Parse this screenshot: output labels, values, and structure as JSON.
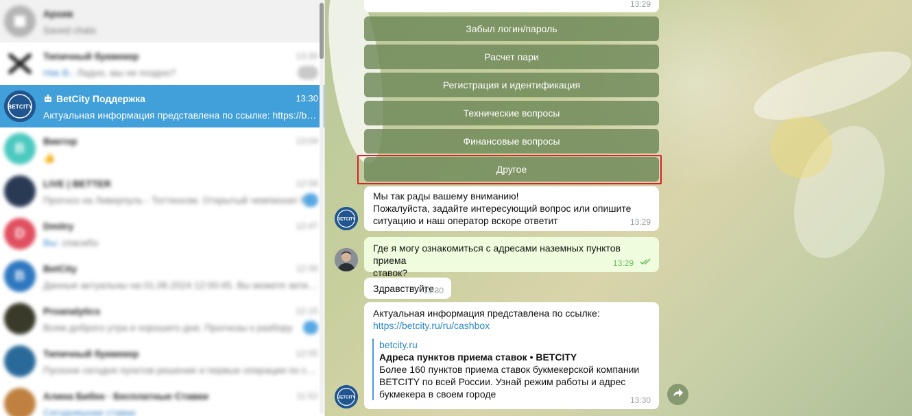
{
  "sidebar": {
    "chats": [
      {
        "title": "Архив",
        "preview": "Saved chats",
        "time": "",
        "avatar_color": "#b0b0b0",
        "blurred": true
      },
      {
        "title": "Типичный букмекер",
        "preview_highlight": "Ник В.:",
        "preview": "Ладно, мы не поздно?",
        "time": "13:30",
        "avatar_color": "#ffffff",
        "badge": "muted",
        "blurred": true
      },
      {
        "title": "BetCity Поддержка",
        "preview": "Актуальная информация представлена по ссылке: https://betcity.ru/ru/cashbox",
        "time": "13:30",
        "active": true,
        "blurred": false
      },
      {
        "title": "Виктор",
        "preview": "👍",
        "time": "13:04",
        "avatar_color": "#4cc9c0",
        "blurred": true
      },
      {
        "title": "LIVE | BETTER",
        "preview": "Прогноз на Ливерпуль - Тоттенхэм. Открытый чемпионат России",
        "time": "12:58",
        "avatar_color": "#2a3a55",
        "badge": "unread",
        "blurred": true
      },
      {
        "title": "Dmitry",
        "preview_highlight": "Вы:",
        "preview": "спасибо",
        "time": "12:47",
        "avatar_color": "#e04f5f",
        "blurred": true
      },
      {
        "title": "BetCity",
        "preview": "Данные актуальны на 01.06.2024 12:00:45. Вы можете активировать",
        "time": "12:30",
        "avatar_color": "#2e78c0",
        "blurred": true
      },
      {
        "title": "Proanalytics",
        "preview": "Всем доброго утра и хорошего дня. Прогнозы к разбору",
        "time": "12:15",
        "avatar_color": "#3a3a2a",
        "badge": "unread",
        "blurred": true
      },
      {
        "title": "Типичный букмекер",
        "preview": "Пусконе сегодня пунктов решение и первые операции по ставкам",
        "time": "12:05",
        "avatar_color": "#2a6a9a",
        "blurred": true
      },
      {
        "title": "Алина Бибек · Бесплатные Ставки",
        "preview": "Сегодняшние ставки",
        "time": "11:52",
        "avatar_color": "#c08040",
        "blurred": true
      }
    ],
    "active_chat": {
      "title": "BetCity Поддержка",
      "time": "13:30",
      "preview": "Актуальная информация представлена по ссылке: https://betcity.ru/ru/cashbox"
    }
  },
  "chat": {
    "top_time": "13:29",
    "keyboard": [
      "Забыл логин/пароль",
      "Расчет пари",
      "Регистрация и идентификация",
      "Технические вопросы",
      "Финансовые вопросы",
      "Другое"
    ],
    "bot_greeting": {
      "lines": [
        "Мы так рады вашему вниманию!",
        "Пожалуйста, задайте интересующий вопрос или опишите",
        "ситуацию и наш оператор вскоре ответит"
      ],
      "time": "13:29"
    },
    "user_question": {
      "lines": [
        "Где я могу ознакомиться с адресами наземных пунктов приема",
        "ставок?"
      ],
      "time": "13:29"
    },
    "hello": {
      "text": "Здравствуйте.",
      "time": "13:30"
    },
    "answer": {
      "text": "Актуальная информация представлена по ссылке:",
      "link": "https://betcity.ru/ru/cashbox",
      "preview_site": "betcity.ru",
      "preview_title": "Адреса пунктов приема ставок • BETCITY",
      "preview_desc": [
        "Более 160 пунктов приема ставок букмекерской компании",
        "BETCITY по всей России. Узнай режим работы и адрес",
        "букмекера в своем городе"
      ],
      "time": "13:30"
    },
    "betcity_logo_text": "BETCITY",
    "colors": {
      "active_chat": "#419fd9",
      "keyboard_button": "#6e8758",
      "outgoing_bubble": "#effdde",
      "highlight": "#d6212b",
      "link": "#2a86c9"
    }
  }
}
